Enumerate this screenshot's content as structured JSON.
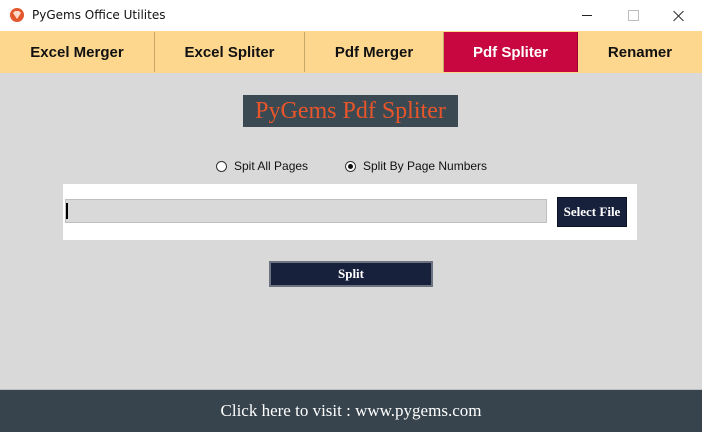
{
  "window": {
    "title": "PyGems Office Utilites",
    "icon": "pygems-logo-icon"
  },
  "tabs": [
    {
      "label": "Excel Merger",
      "active": false
    },
    {
      "label": "Excel Spliter",
      "active": false
    },
    {
      "label": "Pdf Merger",
      "active": false
    },
    {
      "label": "Pdf Spliter",
      "active": true
    },
    {
      "label": "Renamer",
      "active": false
    }
  ],
  "main": {
    "title": "PyGems Pdf Spliter",
    "options": [
      {
        "label": "Spit All Pages",
        "checked": false
      },
      {
        "label": "Split By Page Numbers",
        "checked": true
      }
    ],
    "file_input_value": "",
    "select_button": "Select File",
    "split_button": "Split"
  },
  "footer": {
    "link_text": "Click here to visit : www.pygems.com"
  },
  "colors": {
    "tab_bg": "#fdd78e",
    "tab_active_bg": "#c8063f",
    "button_bg": "#17213c",
    "title_bg": "#3b4a52",
    "title_fg": "#e8552a",
    "footer_bg": "#37444d",
    "body_bg": "#d9d9d9"
  }
}
